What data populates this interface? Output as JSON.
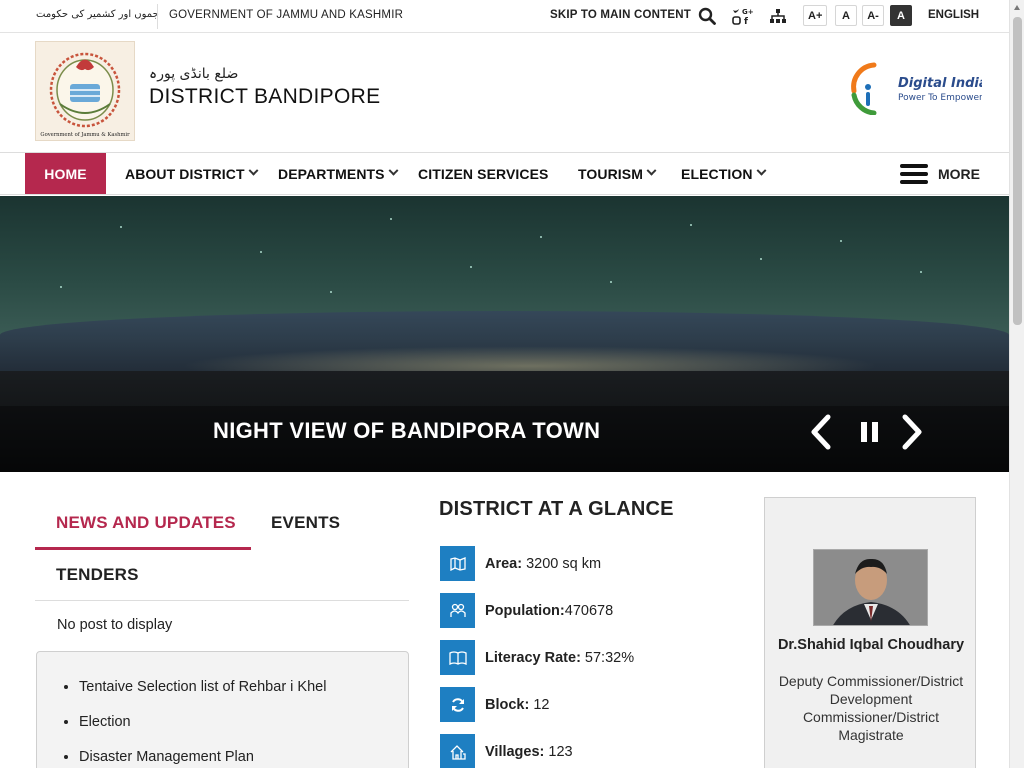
{
  "topbar": {
    "urdu_text": "جموں اور کشمیر کی حکومت",
    "government": "GOVERNMENT OF JAMMU AND KASHMIR",
    "skip": "SKIP TO MAIN CONTENT",
    "font_sizes": [
      "A+",
      "A",
      "A-",
      "A"
    ],
    "language": "ENGLISH"
  },
  "header": {
    "emblem_caption": "Government of Jammu & Kashmir",
    "site_name_urdu": "ضلع بانڈی پورہ",
    "site_name": "DISTRICT BANDIPORE",
    "digital_india_title": "Digital India",
    "digital_india_tagline": "Power To Empower"
  },
  "nav": {
    "items": [
      {
        "label": "HOME"
      },
      {
        "label": "ABOUT DISTRICT"
      },
      {
        "label": "DEPARTMENTS"
      },
      {
        "label": "CITIZEN SERVICES"
      },
      {
        "label": "TOURISM"
      },
      {
        "label": "ELECTION"
      }
    ],
    "more": "MORE"
  },
  "hero": {
    "caption": "NIGHT VIEW OF BANDIPORA TOWN"
  },
  "news": {
    "tabs": [
      "NEWS AND UPDATES",
      "EVENTS",
      "TENDERS"
    ],
    "empty": "No post to display",
    "links": [
      "Tentaive Selection list of Rehbar i Khel",
      "Election",
      "Disaster Management Plan"
    ]
  },
  "glance": {
    "title": "DISTRICT AT A GLANCE",
    "rows": [
      {
        "label": "Area:",
        "value": "3200 sq km",
        "icon": "map-icon"
      },
      {
        "label": "Population:",
        "value": "470678",
        "icon": "people-icon"
      },
      {
        "label": "Literacy Rate:",
        "value": "57:32%",
        "icon": "book-icon"
      },
      {
        "label": "Block:",
        "value": "12",
        "icon": "refresh-icon"
      },
      {
        "label": "Villages:",
        "value": "123",
        "icon": "village-icon"
      }
    ]
  },
  "officer": {
    "name": "Dr.Shahid Iqbal Choudhary",
    "designation": "Deputy Commissioner/District Development Commissioner/District Magistrate"
  },
  "colors": {
    "accent": "#b5284e",
    "icon_blue": "#1e7fc2"
  }
}
